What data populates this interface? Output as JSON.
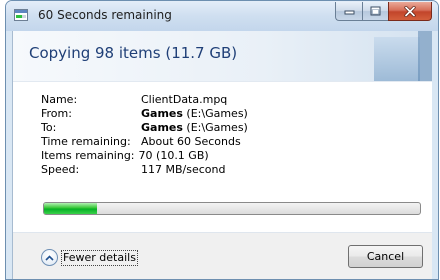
{
  "window": {
    "title": "60 Seconds remaining",
    "icon": "copy-progress-icon",
    "buttons": [
      "minimize",
      "maximize",
      "close"
    ]
  },
  "header": {
    "title": "Copying 98 items (11.7 GB)"
  },
  "details": {
    "name": {
      "label": "Name:",
      "value": "ClientData.mpq"
    },
    "from": {
      "label": "From:",
      "value_bold": "Games",
      "value_rest": " (E:\\Games)"
    },
    "to": {
      "label": "To:",
      "value_bold": "Games",
      "value_rest": " (E:\\Games)"
    },
    "time_remaining": {
      "label": "Time remaining:",
      "value": "About 60 Seconds"
    },
    "items_remaining": {
      "label": "Items remaining:",
      "value": "70 (10.1 GB)"
    },
    "speed": {
      "label": "Speed:",
      "value": "117 MB/second"
    }
  },
  "progress": {
    "fraction": 0.14,
    "color": "#06b025"
  },
  "footer": {
    "fewer_details_label": "Fewer details",
    "cancel_label": "Cancel"
  }
}
